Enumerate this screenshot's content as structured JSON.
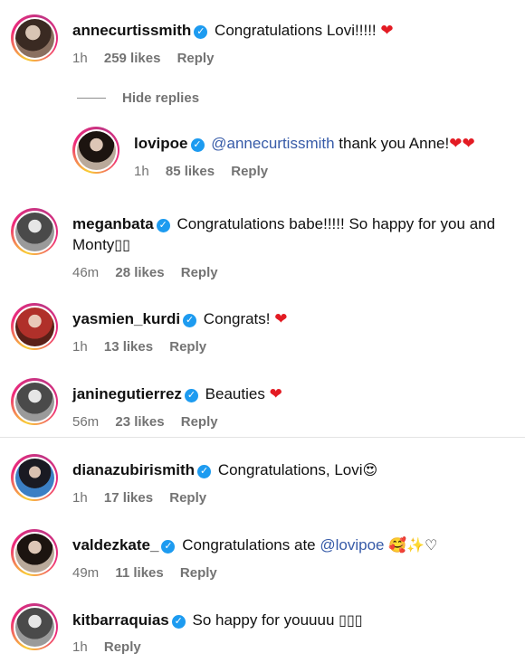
{
  "colors": {
    "verified": "#1d9bf0",
    "mention": "#375ba8",
    "heart": "#e31b23",
    "meta_text": "#737373"
  },
  "comments": [
    {
      "username": "annecurtissmith",
      "text": "Congratulations Lovi!!!!!",
      "emoji": "❤",
      "time": "1h",
      "likes": "259 likes",
      "reply": "Reply"
    },
    {
      "username": "lovipoe",
      "mention": "@annecurtissmith",
      "text": " thank you Anne!",
      "emoji": "❤❤",
      "time": "1h",
      "likes": "85 likes",
      "reply": "Reply"
    },
    {
      "username": "meganbata",
      "text": "Congratulations babe!!!!! So happy for you and",
      "text2": "Monty",
      "emoji": "▯▯",
      "time": "46m",
      "likes": "28 likes",
      "reply": "Reply"
    },
    {
      "username": "yasmien_kurdi",
      "text": "Congrats!",
      "emoji": "❤",
      "time": "1h",
      "likes": "13 likes",
      "reply": "Reply"
    },
    {
      "username": "janinegutierrez",
      "text": "Beauties",
      "emoji": "❤",
      "time": "56m",
      "likes": "23 likes",
      "reply": "Reply"
    },
    {
      "username": "dianazubirismith",
      "text": "Congratulations, Lovi",
      "emoji": "😍",
      "time": "1h",
      "likes": "17 likes",
      "reply": "Reply"
    },
    {
      "username": "valdezkate_",
      "text": "Congratulations ate ",
      "mention": "@lovipoe",
      "emoji": "🥰✨♡",
      "time": "49m",
      "likes": "11 likes",
      "reply": "Reply"
    },
    {
      "username": "kitbarraquias",
      "text": "So happy for youuuu",
      "emoji": "▯▯▯",
      "time": "1h",
      "reply": "Reply"
    }
  ],
  "hide_replies": "Hide replies",
  "verified_icon": "✓"
}
